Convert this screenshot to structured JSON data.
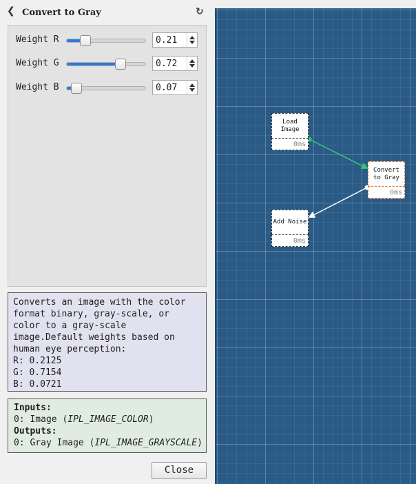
{
  "header": {
    "title": "Convert to Gray"
  },
  "params": [
    {
      "label": "Weight R",
      "value": "0.21",
      "level": 0.24
    },
    {
      "label": "Weight G",
      "value": "0.72",
      "level": 0.68
    },
    {
      "label": "Weight B",
      "value": "0.07",
      "level": 0.12
    }
  ],
  "description": "Converts an image with the color format binary, gray-scale, or color to a gray-scale image.Default weights based on human eye perception:\nR: 0.2125\nG: 0.7154\nB: 0.0721",
  "io": {
    "inputs_label": "Inputs:",
    "input_0_prefix": "0: Image (",
    "input_0_type": "IPL_IMAGE_COLOR",
    "input_0_suffix": ")",
    "outputs_label": "Outputs:",
    "output_0_prefix": "0: Gray Image (",
    "output_0_type": "IPL_IMAGE_GRAYSCALE",
    "output_0_suffix": ")"
  },
  "close_label": "Close",
  "nodes": [
    {
      "line1": "Load",
      "line2": "Image",
      "time": "0ms"
    },
    {
      "line1": "Convert",
      "line2": "to Gray",
      "time": "0ms"
    },
    {
      "line1": "Add Noise",
      "line2": "",
      "time": "0ms"
    }
  ],
  "icons": {
    "back": "chevron-left-icon",
    "reset": "refresh-icon"
  },
  "colors": {
    "accent": "#2f7ad9",
    "canvas": "#2a5a86",
    "wire_active": "#2ecc71",
    "selected_node": "#e07a2e"
  }
}
